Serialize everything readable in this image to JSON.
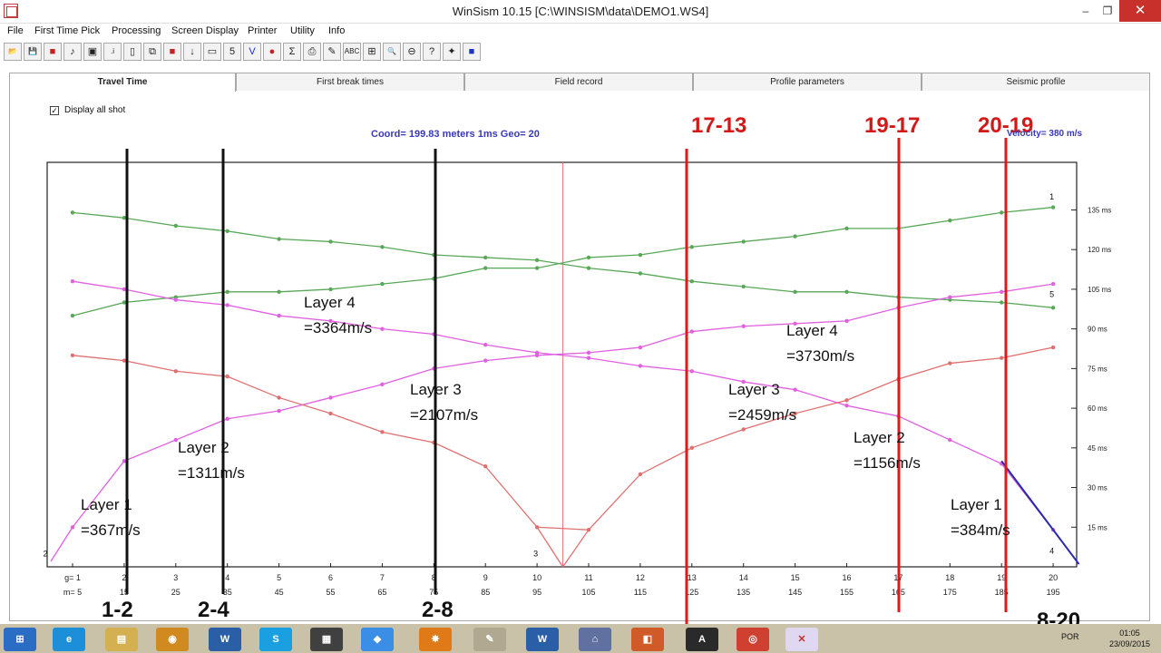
{
  "window": {
    "title": "WinSism 10.15 [C:\\WINSISM\\data\\DEMO1.WS4]",
    "minimize": "‒",
    "restore": "❐",
    "close": "✕"
  },
  "menu": [
    "File",
    "First Time Pick",
    "Processing",
    "Screen Display",
    "Printer",
    "Utility",
    "Info"
  ],
  "toolbar": [
    {
      "name": "open-icon",
      "glyph": "📂"
    },
    {
      "name": "save-icon",
      "glyph": "💾"
    },
    {
      "name": "record-icon",
      "glyph": "■"
    },
    {
      "name": "pick-icon",
      "glyph": "♪"
    },
    {
      "name": "image-icon",
      "glyph": "▣"
    },
    {
      "name": "info-icon",
      "glyph": ".i"
    },
    {
      "name": "new-page-icon",
      "glyph": "▯"
    },
    {
      "name": "copy-icon",
      "glyph": "⧉"
    },
    {
      "name": "stop-icon",
      "glyph": "■"
    },
    {
      "name": "down-arrow-icon",
      "glyph": "↓"
    },
    {
      "name": "window-icon",
      "glyph": "▭"
    },
    {
      "name": "five-icon",
      "glyph": "5"
    },
    {
      "name": "check-icon",
      "glyph": "V"
    },
    {
      "name": "dot-icon",
      "glyph": "●"
    },
    {
      "name": "sum-icon",
      "glyph": "Σ"
    },
    {
      "name": "printer-icon",
      "glyph": "⎙"
    },
    {
      "name": "tool-icon",
      "glyph": "✎"
    },
    {
      "name": "abc-icon",
      "glyph": "ABC"
    },
    {
      "name": "grid-icon",
      "glyph": "⊞"
    },
    {
      "name": "zoom-icon",
      "glyph": "🔍"
    },
    {
      "name": "zoom-out-icon",
      "glyph": "⊖"
    },
    {
      "name": "help-icon",
      "glyph": "?"
    },
    {
      "name": "plugin-icon",
      "glyph": "✦"
    },
    {
      "name": "square-icon",
      "glyph": "■"
    }
  ],
  "tabs": [
    "Travel Time",
    "First break times",
    "Field record",
    "Profile parameters",
    "Seismic profile"
  ],
  "display_all_shot": {
    "label": "Display all shot",
    "checked": "✓"
  },
  "coord_text": "Coord=  199.83 meters 1ms Geo= 20",
  "velocity_text": "Velocity=  380 m/s",
  "chart_data": {
    "type": "line",
    "x_geophones": [
      1,
      2,
      3,
      4,
      5,
      6,
      7,
      8,
      9,
      10,
      11,
      12,
      13,
      14,
      15,
      16,
      17,
      18,
      19,
      20
    ],
    "x_top_labels": [
      "g= 1",
      "2",
      "3",
      "4",
      "5",
      "6",
      "7",
      "8",
      "9",
      "10",
      "11",
      "12",
      "13",
      "14",
      "15",
      "16",
      "17",
      "18",
      "19",
      "20"
    ],
    "x_bottom_labels": [
      "m= 5",
      "15",
      "25",
      "35",
      "45",
      "55",
      "65",
      "75",
      "85",
      "95",
      "105",
      "115",
      "125",
      "135",
      "145",
      "155",
      "165",
      "175",
      "185",
      "195"
    ],
    "y_ticks": [
      15,
      30,
      45,
      60,
      75,
      90,
      105,
      120,
      135
    ],
    "y_tick_labels": [
      "15 ms",
      "30 ms",
      "45 ms",
      "60 ms",
      "75 ms",
      "90 ms",
      "105 ms",
      "120 ms",
      "135 ms"
    ],
    "y_range": [
      0,
      153
    ],
    "shot_marker_geophone": 10.5,
    "series": [
      {
        "color": "#58a858",
        "values": [
          134,
          132,
          129,
          127,
          124,
          123,
          121,
          118,
          117,
          116,
          113,
          111,
          108,
          106,
          104,
          104,
          102,
          101,
          100,
          98
        ]
      },
      {
        "color": "#58a858",
        "values": [
          95,
          100,
          102,
          104,
          104,
          105,
          107,
          109,
          113,
          113,
          117,
          118,
          121,
          123,
          125,
          128,
          128,
          131,
          134,
          136
        ]
      },
      {
        "color": "#e060e0",
        "values": [
          108,
          105,
          101,
          99,
          95,
          93,
          90,
          88,
          84,
          81,
          79,
          76,
          74,
          70,
          67,
          61,
          57,
          48,
          39,
          14
        ]
      },
      {
        "color": "#e060e0",
        "values": [
          15,
          40,
          48,
          56,
          59,
          64,
          69,
          75,
          78,
          80,
          81,
          83,
          89,
          91,
          92,
          93,
          98,
          102,
          104,
          107
        ]
      },
      {
        "color": "#e07070",
        "values": [
          80,
          78,
          74,
          72,
          64,
          58,
          51,
          47,
          38,
          15,
          14,
          35,
          45,
          52,
          58,
          63,
          71,
          77,
          79,
          83
        ]
      }
    ],
    "first_arrival_pts": [
      {
        "label": "2",
        "x": 0.5,
        "y": 4
      },
      {
        "label": "3",
        "x": 10,
        "y": 4
      },
      {
        "label": "1",
        "x": 20,
        "y": 139
      },
      {
        "label": "5",
        "x": 20,
        "y": 102
      },
      {
        "label": "4",
        "x": 20,
        "y": 5
      }
    ],
    "velocity_line": {
      "x1": 19,
      "y1": 40,
      "x2": 20.5,
      "y2": 1
    }
  },
  "annotations": {
    "layers": [
      {
        "text1": "Layer  1",
        "text2": "=367m/s"
      },
      {
        "text1": "Layer  2",
        "text2": "=1311m/s"
      },
      {
        "text1": "Layer 3",
        "text2": "=2107m/s"
      },
      {
        "text1": "Layer 4",
        "text2": "=3364m/s"
      },
      {
        "text1": "Layer 4",
        "text2": "=3730m/s"
      },
      {
        "text1": "Layer 3",
        "text2": "=2459m/s"
      },
      {
        "text1": "Layer  2",
        "text2": "=1156m/s"
      },
      {
        "text1": "Layer  1",
        "text2": "=384m/s"
      }
    ],
    "black_labels": [
      "1-2",
      "2-4",
      "2-8",
      "8-20"
    ],
    "red_labels": [
      "17-13",
      "19-17",
      "20-19"
    ]
  },
  "taskbar": {
    "lang": "POR",
    "time": "01:05",
    "date": "23/09/2015"
  }
}
